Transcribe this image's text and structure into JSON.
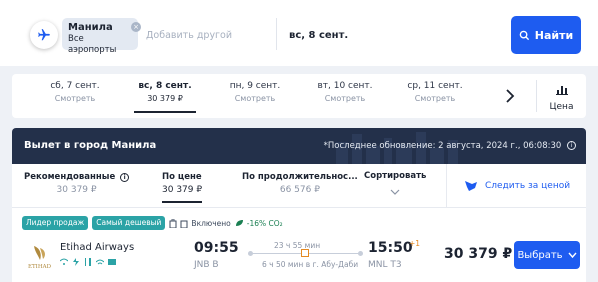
{
  "search": {
    "origin_chip": {
      "title": "Манила",
      "subtitle": "Все аэропорты"
    },
    "add_other_placeholder": "Добавить другой",
    "date_value": "вс, 8 сент.",
    "search_button": "Найти"
  },
  "dates": [
    {
      "day": "сб, 7 сент.",
      "price": "Смотреть",
      "active": false
    },
    {
      "day": "вс, 8 сент.",
      "price": "30 379 ₽",
      "active": true
    },
    {
      "day": "пн, 9 сент.",
      "price": "Смотреть",
      "active": false
    },
    {
      "day": "вт, 10 сент.",
      "price": "Смотреть",
      "active": false
    },
    {
      "day": "ср, 11 сент.",
      "price": "Смотреть",
      "active": false
    }
  ],
  "price_toggle_label": "Цена",
  "band": {
    "title": "Вылет в город Манила",
    "updated": "*Последнее обновление: 2 августа, 2024 г., 06:08:30"
  },
  "sort": {
    "recommended": {
      "label": "Рекомендованные",
      "value": "30 379 ₽"
    },
    "by_price": {
      "label": "По цене",
      "value": "30 379 ₽"
    },
    "by_duration": {
      "label": "По продолжительнос...",
      "value": "66 576 ₽"
    },
    "sort_dropdown": "Сортировать",
    "follow_price": "Следить за ценой"
  },
  "result": {
    "tags": [
      "Лидер продаж",
      "Самый дешевый"
    ],
    "included": "Включено",
    "co2": "-16% CO₂",
    "airline": "Etihad Airways",
    "dep_time": "09:55",
    "dep_airport": "JNB B",
    "duration": "23 ч 55 мин",
    "layover": "6 ч 50 мин в г. Абу-Даби",
    "arr_time": "15:50",
    "arr_plus": "+1",
    "arr_airport": "MNL T3",
    "price": "30 379 ₽",
    "select_button": "Выбрать"
  },
  "colors": {
    "accent": "#1e5cf0",
    "band": "#23304a",
    "tag": "#2ba3a6",
    "stop": "#e58a22"
  }
}
